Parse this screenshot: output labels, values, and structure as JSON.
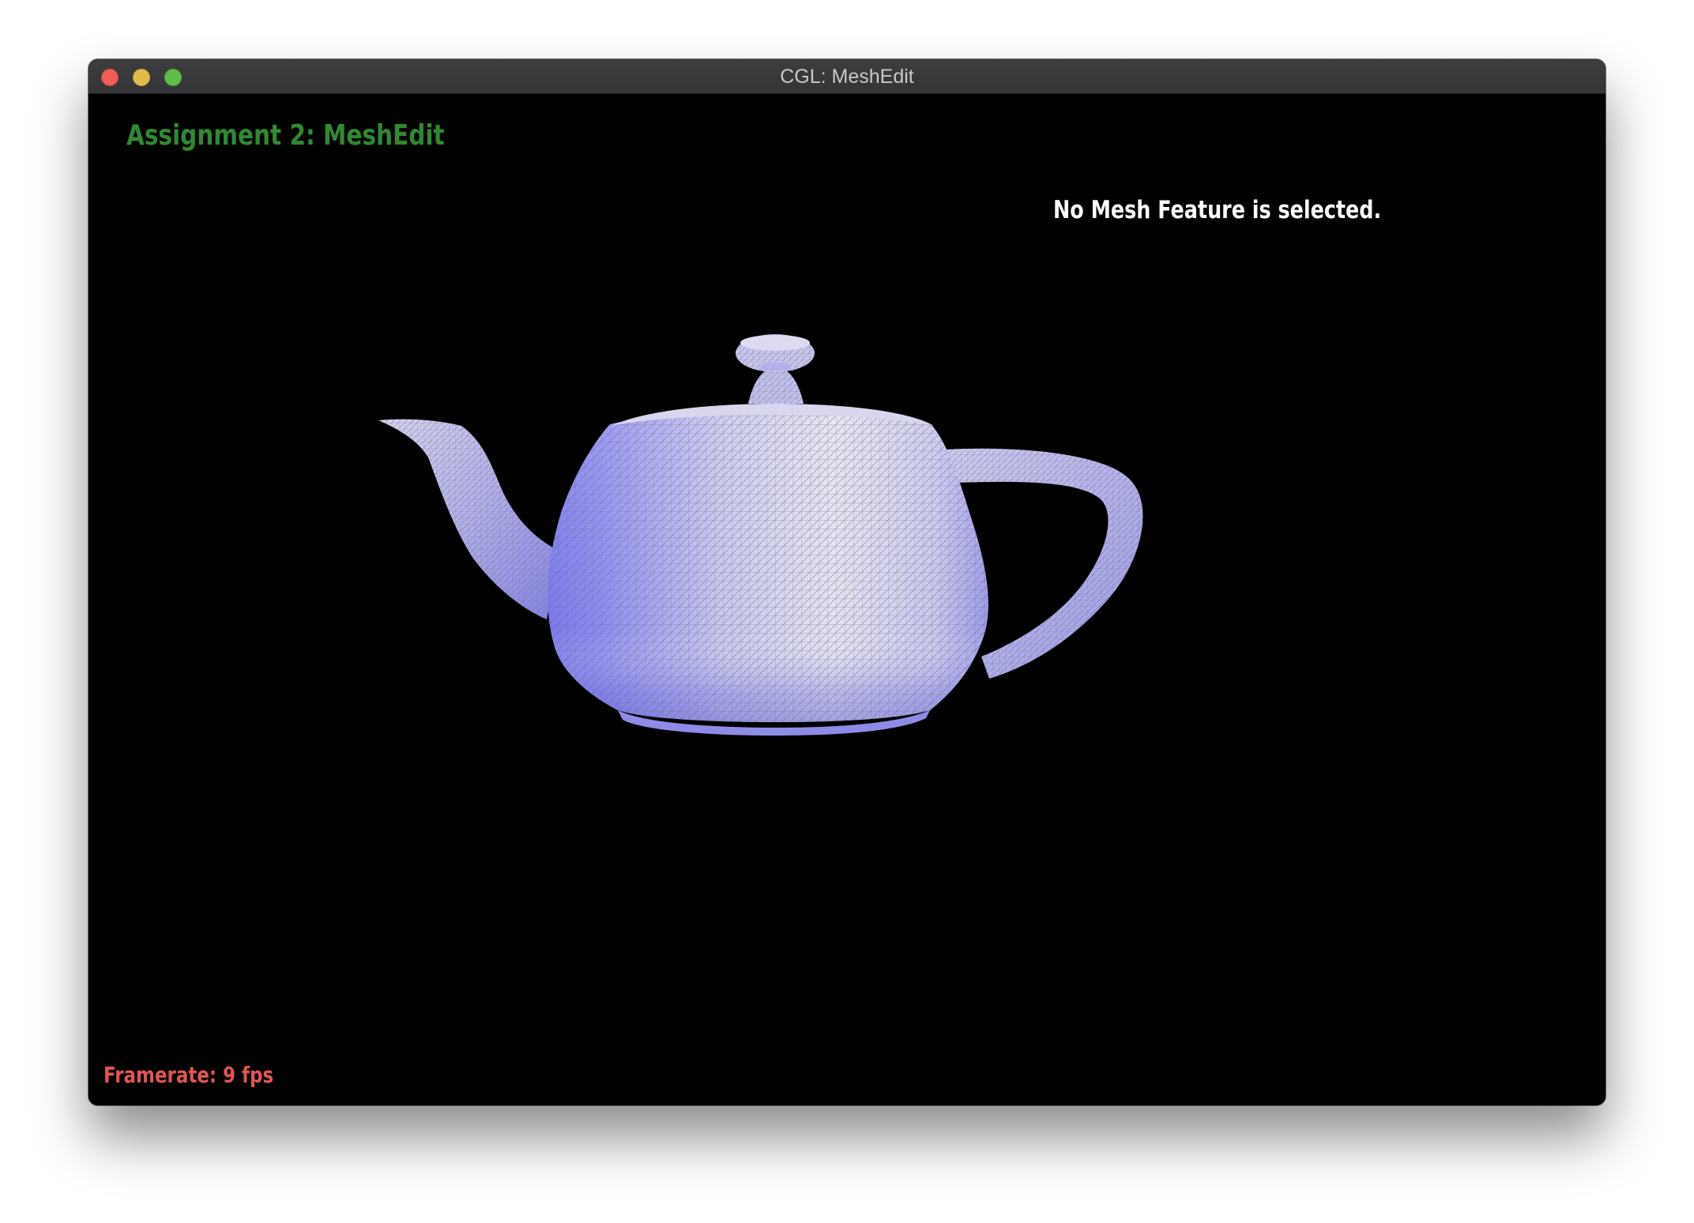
{
  "window": {
    "title": "CGL: MeshEdit"
  },
  "overlay": {
    "assignment_title": "Assignment 2: MeshEdit",
    "selection_status": "No Mesh Feature is selected.",
    "framerate": "Framerate: 9 fps"
  },
  "colors": {
    "assignment_title": "#2f8a2f",
    "selection_status": "#ffffff",
    "framerate": "#e0574f",
    "mesh_fill": "#a9a8f0",
    "background": "#000000"
  },
  "viewport": {
    "model": "teapot-mesh",
    "render_style": "shaded-wireframe"
  }
}
